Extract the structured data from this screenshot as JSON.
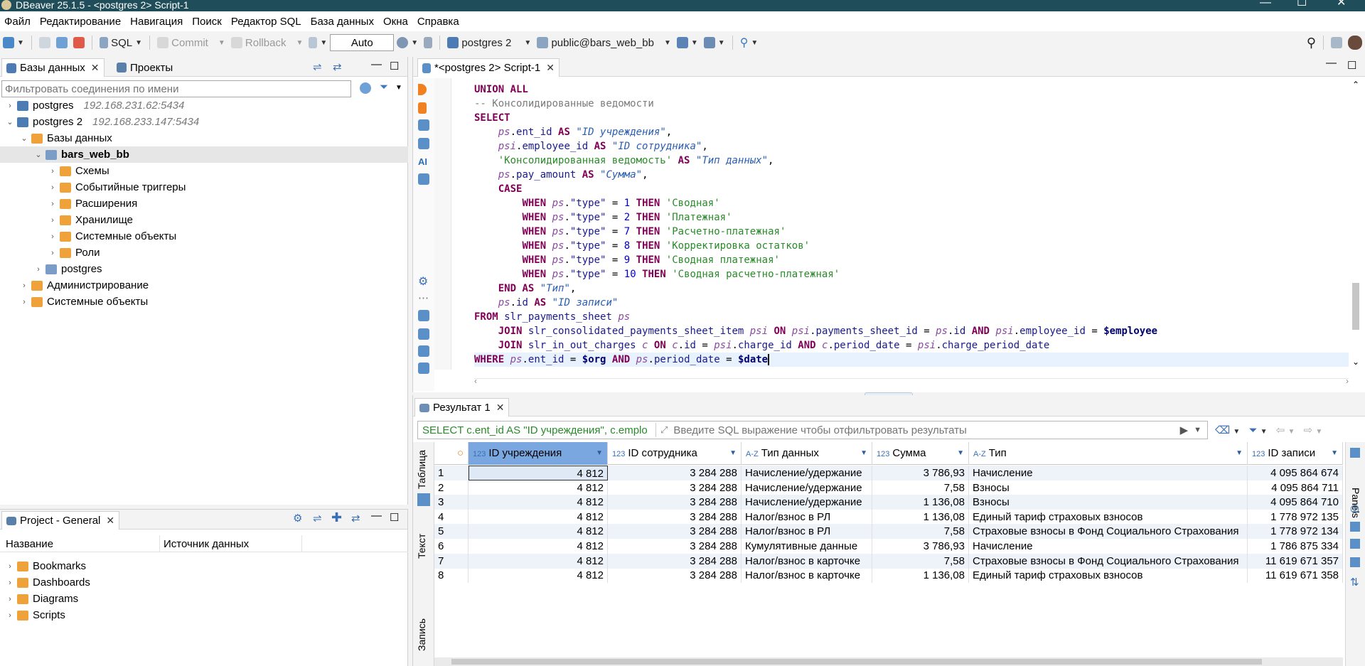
{
  "window": {
    "title": "DBeaver 25.1.5 - <postgres 2> Script-1"
  },
  "menu": [
    "Файл",
    "Редактирование",
    "Навигация",
    "Поиск",
    "Редактор SQL",
    "База данных",
    "Окна",
    "Справка"
  ],
  "toolbar": {
    "sql_label": "SQL",
    "commit_label": "Commit",
    "rollback_label": "Rollback",
    "tx_mode": "Auto",
    "connection": "postgres 2",
    "schema": "public@bars_web_bb"
  },
  "left_panel": {
    "tabs": [
      {
        "label": "Базы данных"
      },
      {
        "label": "Проекты"
      }
    ],
    "filter_placeholder": "Фильтровать соединения по имени",
    "tree": [
      {
        "label": "postgres",
        "host": "192.168.231.62:5434"
      },
      {
        "label": "postgres 2",
        "host": "192.168.233.147:5434"
      },
      {
        "label": "Базы данных"
      },
      {
        "label": "bars_web_bb"
      },
      {
        "label": "Схемы"
      },
      {
        "label": "Событийные триггеры"
      },
      {
        "label": "Расширения"
      },
      {
        "label": "Хранилище"
      },
      {
        "label": "Системные объекты"
      },
      {
        "label": "Роли"
      },
      {
        "label": "postgres"
      },
      {
        "label": "Администрирование"
      },
      {
        "label": "Системные объекты"
      }
    ]
  },
  "project_panel": {
    "tab": "Project - General",
    "columns": [
      "Название",
      "Источник данных"
    ],
    "items": [
      "Bookmarks",
      "Dashboards",
      "Diagrams",
      "Scripts"
    ]
  },
  "editor": {
    "tab": "*<postgres 2> Script-1",
    "code_lines": [
      "UNION ALL",
      "-- Консолидированные ведомости",
      "SELECT",
      "    ps.ent_id AS \"ID учреждения\",",
      "    psi.employee_id AS \"ID сотрудника\",",
      "    'Консолидированная ведомость' AS \"Тип данных\",",
      "    ps.pay_amount AS \"Сумма\",",
      "    CASE",
      "        WHEN ps.\"type\" = 1 THEN 'Сводная'",
      "        WHEN ps.\"type\" = 2 THEN 'Платежная'",
      "        WHEN ps.\"type\" = 7 THEN 'Расчетно-платежная'",
      "        WHEN ps.\"type\" = 8 THEN 'Корректировка остатков'",
      "        WHEN ps.\"type\" = 9 THEN 'Сводная платежная'",
      "        WHEN ps.\"type\" = 10 THEN 'Сводная расчетно-платежная'",
      "    END AS \"Тип\",",
      "    ps.id AS \"ID записи\"",
      "FROM slr_payments_sheet ps",
      "    JOIN slr_consolidated_payments_sheet_item psi ON psi.payments_sheet_id = ps.id AND psi.employee_id = $employee",
      "    JOIN slr_in_out_charges c ON c.id = psi.charge_id AND c.period_date = psi.charge_period_date",
      "WHERE ps.ent_id = $org AND ps.period_date = $date"
    ]
  },
  "results": {
    "tab": "Результат 1",
    "query_preview": "SELECT c.ent_id AS \"ID учреждения\", c.emplo",
    "filter_placeholder": "Введите SQL выражение чтобы отфильтровать результаты",
    "side_tabs": [
      "Таблица",
      "Текст",
      "Запись"
    ],
    "right_tab": "Panels",
    "columns": [
      {
        "type": "123",
        "name": "ID учреждения"
      },
      {
        "type": "123",
        "name": "ID сотрудника"
      },
      {
        "type": "A-Z",
        "name": "Тип данных"
      },
      {
        "type": "123",
        "name": "Сумма"
      },
      {
        "type": "A-Z",
        "name": "Тип"
      },
      {
        "type": "123",
        "name": "ID записи"
      }
    ],
    "rows": [
      [
        "1",
        "4 812",
        "3 284 288",
        "Начисление/удержание",
        "3 786,93",
        "Начисление",
        "4 095 864 674"
      ],
      [
        "2",
        "4 812",
        "3 284 288",
        "Начисление/удержание",
        "7,58",
        "Взносы",
        "4 095 864 711"
      ],
      [
        "3",
        "4 812",
        "3 284 288",
        "Начисление/удержание",
        "1 136,08",
        "Взносы",
        "4 095 864 710"
      ],
      [
        "4",
        "4 812",
        "3 284 288",
        "Налог/взнос в РЛ",
        "1 136,08",
        "Единый тариф страховых взносов",
        "1 778 972 135"
      ],
      [
        "5",
        "4 812",
        "3 284 288",
        "Налог/взнос в РЛ",
        "7,58",
        "Страховые взносы в Фонд Социального Страхования",
        "1 778 972 134"
      ],
      [
        "6",
        "4 812",
        "3 284 288",
        "Кумулятивные данные",
        "3 786,93",
        "Начисление",
        "1 786 875 334"
      ],
      [
        "7",
        "4 812",
        "3 284 288",
        "Налог/взнос в карточке",
        "7,58",
        "Страховые взносы в Фонд Социального Страхования",
        "11 619 671 357"
      ],
      [
        "8",
        "4 812",
        "3 284 288",
        "Налог/взнос в карточке",
        "1 136,08",
        "Единый тариф страховых взносов",
        "11 619 671 358"
      ]
    ]
  }
}
